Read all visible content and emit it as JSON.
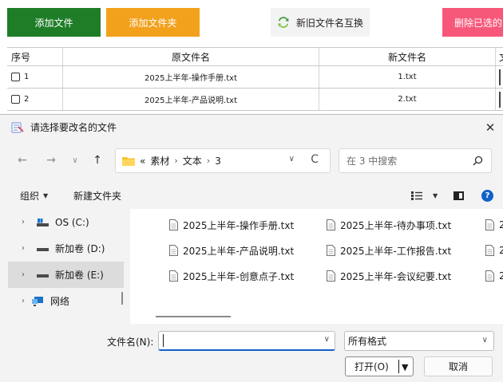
{
  "toolbar": {
    "add_file": "添加文件",
    "add_folder": "添加文件夹",
    "swap": "新旧文件名互换",
    "delete": "删除已选的"
  },
  "table": {
    "headers": {
      "index": "序号",
      "old_name": "原文件名",
      "new_name": "新文件名",
      "extra": "文"
    },
    "rows": [
      {
        "index": "1",
        "old_name": "2025上半年-操作手册.txt",
        "new_name": "1.txt",
        "checked": false
      },
      {
        "index": "2",
        "old_name": "2025上半年-产品说明.txt",
        "new_name": "2.txt",
        "checked": false
      }
    ]
  },
  "dialog": {
    "title": "请选择要改名的文件",
    "close_glyph": "✕",
    "nav": {
      "back_icon": "←",
      "forward_icon": "→",
      "recent_icon": "∨",
      "up_icon": "↑",
      "refresh_icon": "C"
    },
    "address": {
      "overflow": "«",
      "segments": [
        "素材",
        "文本",
        "3"
      ]
    },
    "search": {
      "placeholder": "在 3 中搜索"
    },
    "commands": {
      "organize": "组织",
      "new_folder": "新建文件夹"
    },
    "tree": [
      {
        "label": "OS (C:)",
        "icon": "os-drive-icon",
        "selected": false
      },
      {
        "label": "新加卷 (D:)",
        "icon": "drive-icon",
        "selected": false
      },
      {
        "label": "新加卷 (E:)",
        "icon": "drive-icon",
        "selected": true
      },
      {
        "label": "网络",
        "icon": "network-icon",
        "selected": false
      }
    ],
    "files": {
      "col1": [
        "2025上半年-操作手册.txt",
        "2025上半年-产品说明.txt",
        "2025上半年-创意点子.txt"
      ],
      "col2": [
        "2025上半年-待办事项.txt",
        "2025上半年-工作报告.txt",
        "2025上半年-会议纪要.txt"
      ],
      "col3": [
        "2",
        "2",
        "2"
      ]
    },
    "filename_label": "文件名(N):",
    "filename_value": "",
    "file_type": "所有格式",
    "open_button": "打开(O)",
    "cancel_button": "取消"
  },
  "colors": {
    "add_file_bg": "#1f7d27",
    "add_folder_bg": "#f2a11d",
    "delete_bg": "#f7587a",
    "accent_blue": "#1062c8"
  }
}
